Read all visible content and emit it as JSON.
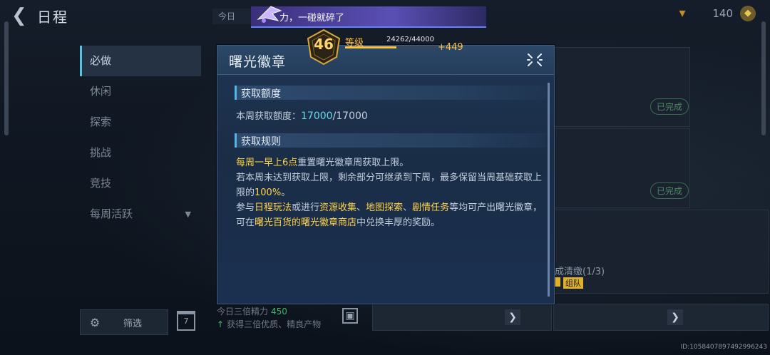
{
  "header": {
    "title": "日程",
    "today_chip": "今日",
    "currency_amount": "140"
  },
  "toast": {
    "message": "力，一碰就碎了"
  },
  "level": {
    "number": "46",
    "label": "等级",
    "xp_text": "24262/44000",
    "xp_fraction": 0.551,
    "gain": "+449"
  },
  "side_menu": {
    "items": [
      {
        "label": "必做",
        "active": true
      },
      {
        "label": "休闲"
      },
      {
        "label": "探索"
      },
      {
        "label": "挑战"
      },
      {
        "label": "竞技"
      },
      {
        "label": "每周活跃"
      }
    ],
    "filter_label": "筛选",
    "calendar_day": "7"
  },
  "cards": {
    "done_label_1": "已完成",
    "done_label_2": "已完成",
    "task_text": "成清缴(1/3)",
    "tag_2": "组队"
  },
  "bottom": {
    "triple_label": "今日三倍精力",
    "triple_value": "450",
    "triple_sub": "获得三倍优质、精良产物"
  },
  "id_text": "ID:1058407897492996243",
  "modal": {
    "title": "曙光徽章",
    "section1_title": "获取额度",
    "quota_label": "本周获取额度：",
    "quota_current": "17000",
    "quota_max": "/17000",
    "section2_title": "获取规则",
    "rule1_hl": "每周一早上6点",
    "rule1_rest": "重置曙光徽章周获取上限。",
    "rule2_a": "若本周未达到获取上限，剩余部分可继承到下周，最多保留当周基础获取上限的",
    "rule2_hl": "100%",
    "rule2_b": "。",
    "rule3_a": "参与",
    "rule3_hl1": "日程玩法",
    "rule3_b": "或进行",
    "rule3_hl2": "资源收集",
    "rule3_c": "、",
    "rule3_hl3": "地图探索",
    "rule3_d": "、",
    "rule3_hl4": "剧情任务",
    "rule3_e": "等均可产出曙光徽章，可在",
    "rule3_hl5": "曙光百货的曙光徽章商店",
    "rule3_f": "中兑换丰厚的奖励。"
  }
}
